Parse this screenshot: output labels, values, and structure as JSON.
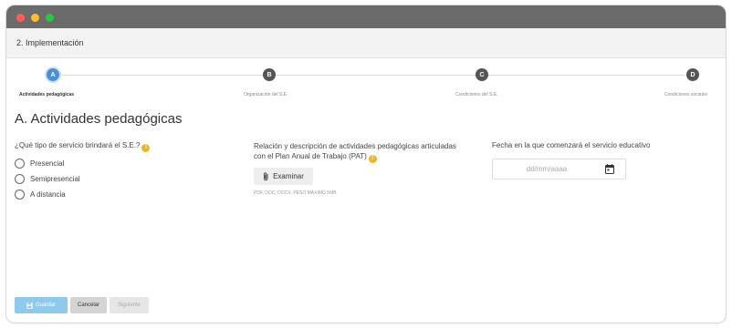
{
  "window": {
    "controls": [
      {
        "name": "close",
        "color": "#ff5f57"
      },
      {
        "name": "minimize",
        "color": "#febc2e"
      },
      {
        "name": "maximize",
        "color": "#28c840"
      }
    ]
  },
  "header": {
    "title": "2. Implementación"
  },
  "stepper": {
    "steps": [
      {
        "letter": "A",
        "label": "Actividades pedagógicas",
        "active": true
      },
      {
        "letter": "B",
        "label": "Organización del S.E.",
        "active": false
      },
      {
        "letter": "C",
        "label": "Condiciones del S.E.",
        "active": false
      },
      {
        "letter": "D",
        "label": "Condiciones sociales",
        "active": false
      }
    ],
    "active_color": "#4a90d9",
    "inactive_color": "#555555"
  },
  "section": {
    "title": "A. Actividades pedagógicas"
  },
  "service_type": {
    "question": "¿Qué tipo de servicio brindará el S.E.?",
    "options": [
      "Presencial",
      "Semipresencial",
      "A distancia"
    ]
  },
  "pat": {
    "label_line1": "Relación y descripción de actividades pedagógicas articuladas",
    "label_line2": "con el Plan Anual de Trabajo (PAT)",
    "button_label": "Examinar",
    "hint": "PDF, DOC, DOCX. PESO MÁXIMO 5MB"
  },
  "start_date": {
    "label": "Fecha en la que comenzará el servicio educativo",
    "placeholder": "dd/mm/aaaa"
  },
  "info_icon": {
    "glyph": "!",
    "color": "#f0b429"
  },
  "footer": {
    "save_label": "Guardar",
    "cancel_label": "Cancelar",
    "next_label": "Siguiente",
    "save_color": "#8ec9ee",
    "cancel_color": "#d4d4d4",
    "next_color": "#e6e6e6"
  }
}
